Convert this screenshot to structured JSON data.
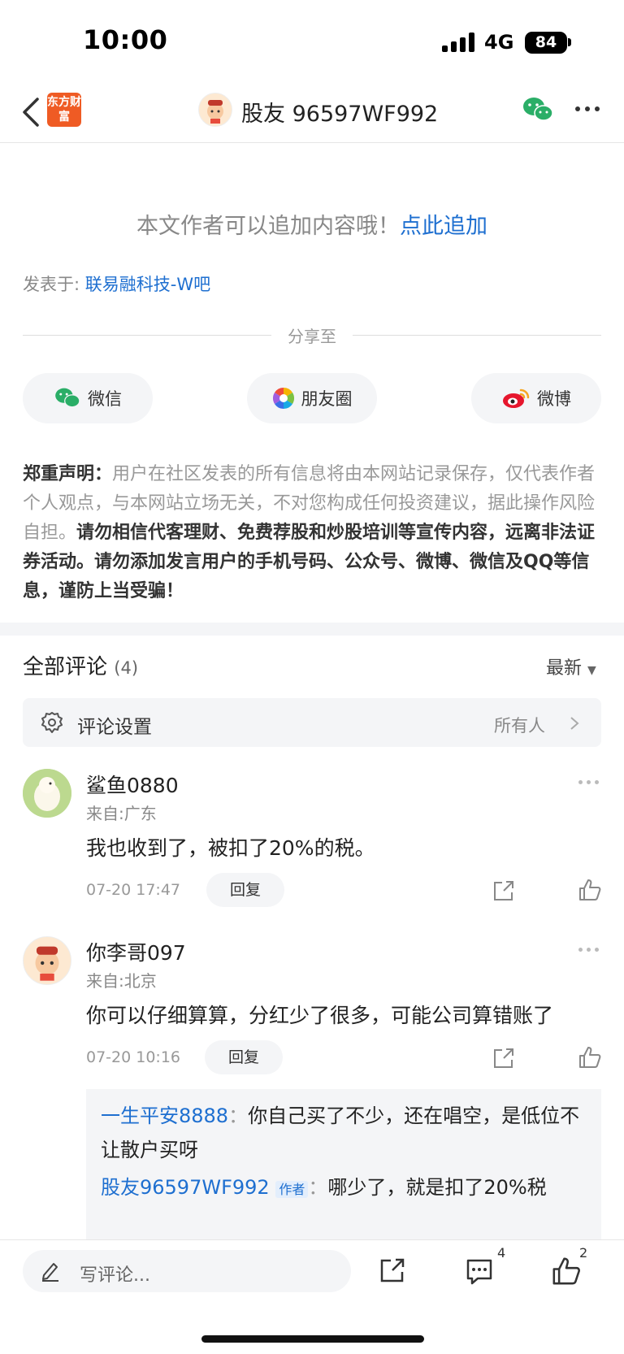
{
  "status_bar": {
    "time": "10:00",
    "network": "4G",
    "battery": "84"
  },
  "nav": {
    "logo_text": "东方财富",
    "title": "股友 96597WF992"
  },
  "append_tip": {
    "text": "本文作者可以追加内容哦！",
    "link": "点此追加"
  },
  "posted_in": {
    "prefix": "发表于:",
    "bar": "联易融科技-W吧"
  },
  "share": {
    "title": "分享至",
    "options": [
      {
        "label": "微信",
        "icon": "wechat-icon"
      },
      {
        "label": "朋友圈",
        "icon": "moments-icon"
      },
      {
        "label": "微博",
        "icon": "weibo-icon"
      }
    ]
  },
  "disclaimer": {
    "label": "郑重声明：",
    "normal": "用户在社区发表的所有信息将由本网站记录保存，仅代表作者个人观点，与本网站立场无关，不对您构成任何投资建议，据此操作风险自担。",
    "bold": "请勿相信代客理财、免费荐股和炒股培训等宣传内容，远离非法证券活动。请勿添加发言用户的手机号码、公众号、微博、微信及QQ等信息，谨防上当受骗！"
  },
  "comments": {
    "title": "全部评论",
    "count": "(4)",
    "sort": "最新",
    "settings_label": "评论设置",
    "settings_value": "所有人",
    "items": [
      {
        "user": "鲨鱼0880",
        "location": "来自:广东",
        "text": "我也收到了，被扣了20%的税。",
        "date": "07-20 17:47",
        "reply": "回复"
      },
      {
        "user": "你李哥097",
        "location": "来自:北京",
        "text": "你可以仔细算算，分红少了很多，可能公司算错账了",
        "date": "07-20 10:16",
        "reply": "回复"
      }
    ],
    "sub_replies": [
      {
        "who": "一生平安8888",
        "sep": "：",
        "text": "你自己买了不少，还在唱空，是低位不让散户买呀"
      },
      {
        "who": "股友96597WF992",
        "tag": "作者",
        "sep": "：",
        "text": "哪少了，就是扣了20%税"
      }
    ]
  },
  "bottom_bar": {
    "placeholder": "写评论...",
    "comment_count": "4",
    "like_count": "2"
  }
}
